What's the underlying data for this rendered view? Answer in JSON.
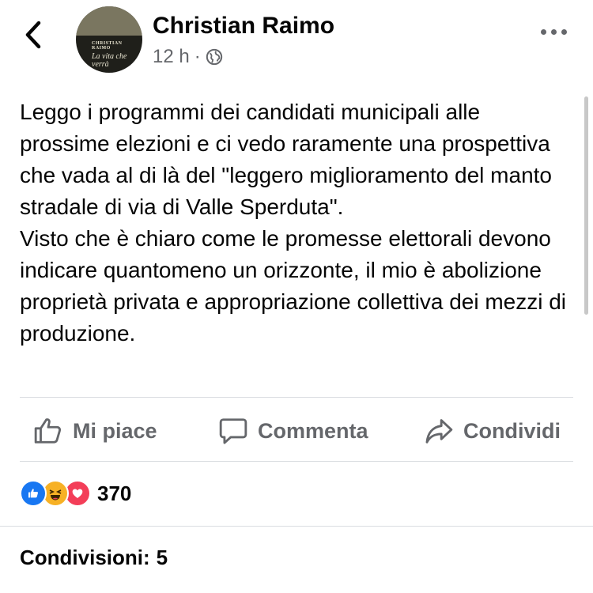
{
  "post": {
    "author": "Christian Raimo",
    "time": "12 h",
    "separator": "·",
    "privacy_icon": "globe-icon",
    "avatar": {
      "book_author": "CHRISTIAN RAIMO",
      "book_title": "La vita che verrà"
    },
    "text": "Leggo i programmi dei candidati municipali alle prossime elezioni e ci vedo raramente una prospettiva che vada al di là del \"leggero miglioramento del manto stradale di via di Valle Sperduta\".\nVisto che è chiaro come le promesse elettorali devono indicare quantomeno un orizzonte, il mio è abolizione proprietà privata e appropriazione collettiva dei mezzi di produzione."
  },
  "actions": {
    "like_label": "Mi piace",
    "comment_label": "Commenta",
    "share_label": "Condividi"
  },
  "reactions": {
    "types": [
      "like",
      "haha",
      "love"
    ],
    "count": "370"
  },
  "shares": {
    "label": "Condivisioni:",
    "count": "5"
  },
  "colors": {
    "text": "#050505",
    "secondary": "#65676b",
    "like": "#1877f2",
    "haha": "#f7b125",
    "love": "#f33e58"
  }
}
